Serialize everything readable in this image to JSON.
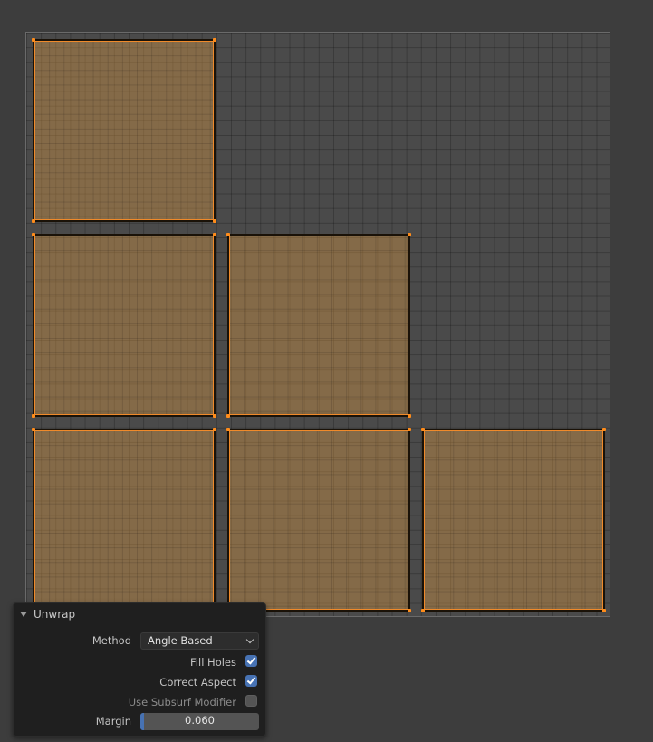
{
  "panel": {
    "title": "Unwrap",
    "method": {
      "label": "Method",
      "value": "Angle Based"
    },
    "fill_holes": {
      "label": "Fill Holes",
      "checked": true
    },
    "correct_aspect": {
      "label": "Correct Aspect",
      "checked": true
    },
    "use_subsurf": {
      "label": "Use Subsurf Modifier",
      "checked": false
    },
    "margin": {
      "label": "Margin",
      "value": "0.060",
      "fraction": 0.03
    }
  },
  "uv_islands_count": 6,
  "colors": {
    "background": "#3d3d3d",
    "uv_grid": "#4a4a4a",
    "island_fill": "#7a5c3c",
    "selection_edge": "#f08a2a",
    "vertex": "#ff8c1a",
    "accent": "#4772b3"
  }
}
